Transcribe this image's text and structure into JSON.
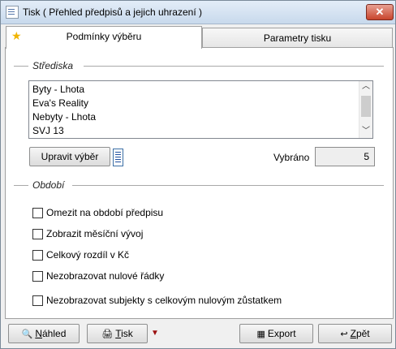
{
  "window": {
    "title": "Tisk ( Přehled předpisů a jejich uhrazení )",
    "close_label": "✕"
  },
  "tabs": [
    {
      "label": "Podmínky výběru",
      "icon": "star-icon"
    },
    {
      "label": "Parametry tisku"
    }
  ],
  "strediska": {
    "label": "Střediska",
    "items": [
      "Byty - Lhota",
      "Eva's Reality",
      "Nebyty - Lhota",
      "SVJ 13"
    ],
    "select_button": "Upravit výběr",
    "count_label": "Vybráno",
    "count_value": "5"
  },
  "obdobi": {
    "label": "Období",
    "options": [
      {
        "label": "Omezit na období předpisu",
        "checked": false
      },
      {
        "label": "Zobrazit měsíční vývoj",
        "checked": false
      },
      {
        "label": "Celkový rozdíl v Kč",
        "checked": false
      },
      {
        "label": "Nezobrazovat nulové řádky",
        "checked": false
      },
      {
        "label": "Nezobrazovat subjekty s celkovým nulovým zůstatkem",
        "checked": false
      }
    ]
  },
  "buttons": {
    "preview": {
      "first": "N",
      "rest": "áhled"
    },
    "print": {
      "first": "T",
      "rest": "isk"
    },
    "export": "Export",
    "back": {
      "first": "Z",
      "rest": "pět"
    }
  }
}
